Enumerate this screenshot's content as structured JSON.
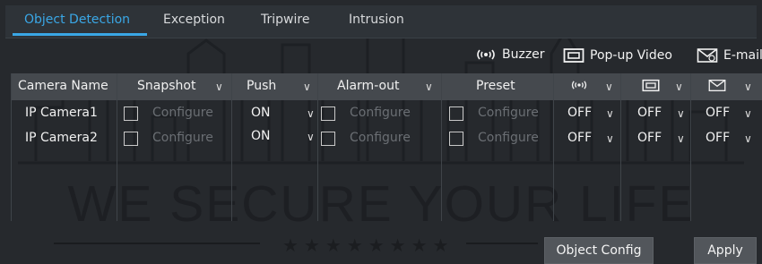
{
  "tabs": [
    {
      "label": "Object Detection",
      "active": true
    },
    {
      "label": "Exception"
    },
    {
      "label": "Tripwire"
    },
    {
      "label": "Intrusion"
    }
  ],
  "actions": {
    "buzzer": {
      "label": "Buzzer",
      "icon": "buzzer-icon"
    },
    "popup_video": {
      "label": "Pop-up Video",
      "icon": "popup-video-icon"
    },
    "email": {
      "label": "E-mail",
      "icon": "email-icon"
    }
  },
  "table": {
    "headers": {
      "camera_name": "Camera Name",
      "snapshot": "Snapshot",
      "push": "Push",
      "alarm_out": "Alarm-out",
      "preset": "Preset"
    },
    "rows": [
      {
        "camera": "IP Camera1",
        "snapshot": "Configure",
        "push": "ON",
        "alarm_out": "Configure",
        "preset": "Configure",
        "buzzer": "OFF",
        "popup": "OFF",
        "email": "OFF"
      },
      {
        "camera": "IP Camera2",
        "snapshot": "Configure",
        "push": "ON",
        "alarm_out": "Configure",
        "preset": "Configure",
        "buzzer": "OFF",
        "popup": "OFF",
        "email": "OFF"
      }
    ]
  },
  "watermark": "WE SECURE YOUR LIFE",
  "buttons": {
    "object_config": "Object Config",
    "apply": "Apply"
  },
  "colors": {
    "accent": "#3aa7e6",
    "background": "#26292d",
    "header": "#45494e"
  }
}
